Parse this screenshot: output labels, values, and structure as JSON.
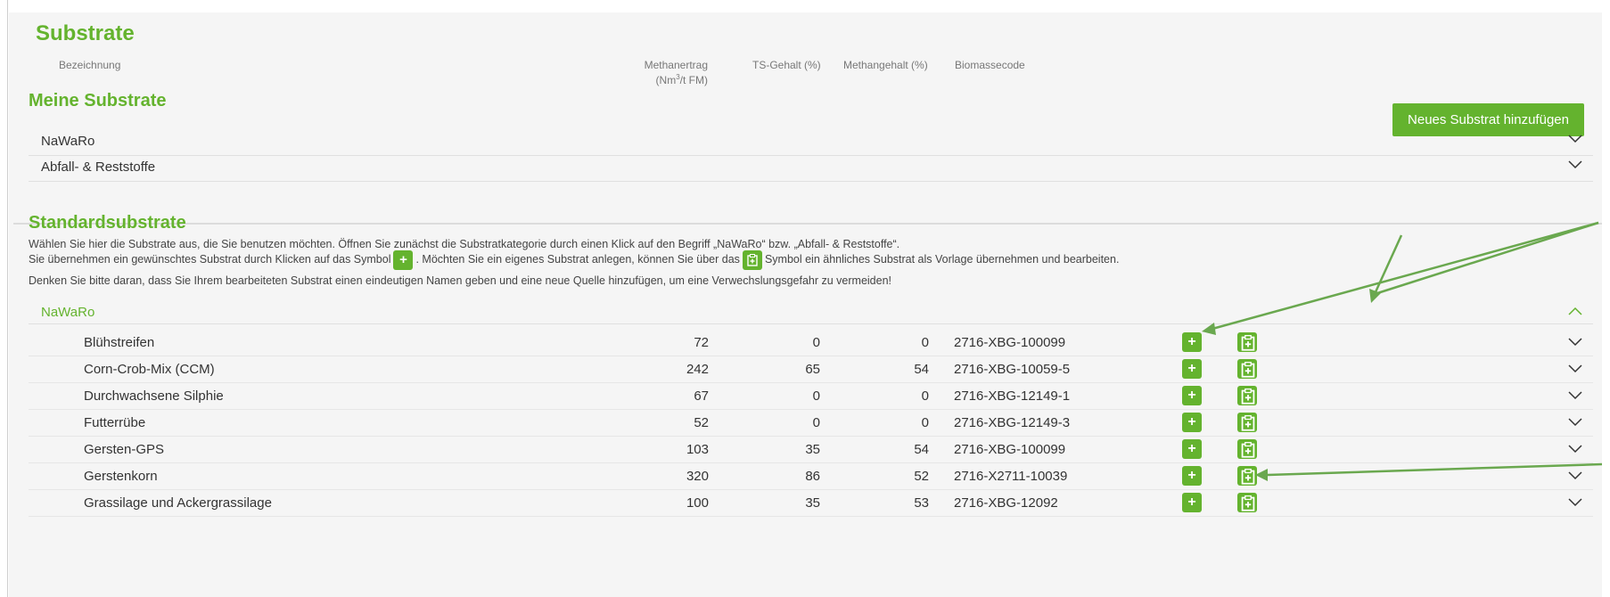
{
  "title": "Substrate",
  "columns": {
    "name": "Bezeichnung",
    "methane_yield": "Methanertrag",
    "methane_yield_unit_pre": "(Nm",
    "methane_yield_unit_sup": "3",
    "methane_yield_unit_post": "/t FM)",
    "ts": "TS-Gehalt (%)",
    "methane_content": "Methangehalt (%)",
    "biomass_code": "Biomassecode"
  },
  "my_substrates": {
    "title": "Meine Substrate",
    "add_button": "Neues Substrat hinzufügen",
    "categories": [
      "NaWaRo",
      "Abfall- & Reststoffe"
    ]
  },
  "standard": {
    "title": "Standardsubstrate",
    "intro_line1": "Wählen Sie hier die Substrate aus, die Sie benutzen möchten. Öffnen Sie zunächst die Substratkategorie durch einen Klick auf den Begriff „NaWaRo“ bzw. „Abfall- & Reststoffe“.",
    "intro_line2_a": "Sie übernehmen ein gewünschtes Substrat durch Klicken auf das Symbol",
    "intro_line2_b": ". Möchten Sie ein eigenes Substrat anlegen, können Sie über das",
    "intro_line2_c": "Symbol ein ähnliches Substrat als Vorlage übernehmen und bearbeiten.",
    "intro_line3": "Denken Sie bitte daran, dass Sie Ihrem bearbeiteten Substrat einen eindeutigen Namen geben und eine neue Quelle hinzufügen, um eine Verwechslungsgefahr zu vermeiden!",
    "category": "NaWaRo",
    "add_symbol": "+",
    "rows": [
      {
        "name": "Blühstreifen",
        "methane_yield": "72",
        "ts": "0",
        "methane": "0",
        "code": "2716-XBG-100099"
      },
      {
        "name": "Corn-Crob-Mix (CCM)",
        "methane_yield": "242",
        "ts": "65",
        "methane": "54",
        "code": "2716-XBG-10059-5"
      },
      {
        "name": "Durchwachsene Silphie",
        "methane_yield": "67",
        "ts": "0",
        "methane": "0",
        "code": "2716-XBG-12149-1"
      },
      {
        "name": "Futterrübe",
        "methane_yield": "52",
        "ts": "0",
        "methane": "0",
        "code": "2716-XBG-12149-3"
      },
      {
        "name": "Gersten-GPS",
        "methane_yield": "103",
        "ts": "35",
        "methane": "54",
        "code": "2716-XBG-100099"
      },
      {
        "name": "Gerstenkorn",
        "methane_yield": "320",
        "ts": "86",
        "methane": "52",
        "code": "2716-X2711-10039"
      },
      {
        "name": "Grassilage und Ackergrassilage",
        "methane_yield": "100",
        "ts": "35",
        "methane": "53",
        "code": "2716-XBG-12092"
      }
    ]
  },
  "colors": {
    "accent": "#64b32e",
    "panel_bg": "#f5f5f5"
  },
  "icons": {
    "expand": "chevron-down-icon",
    "collapse": "chevron-up-icon",
    "copy": "copy-template-icon"
  }
}
